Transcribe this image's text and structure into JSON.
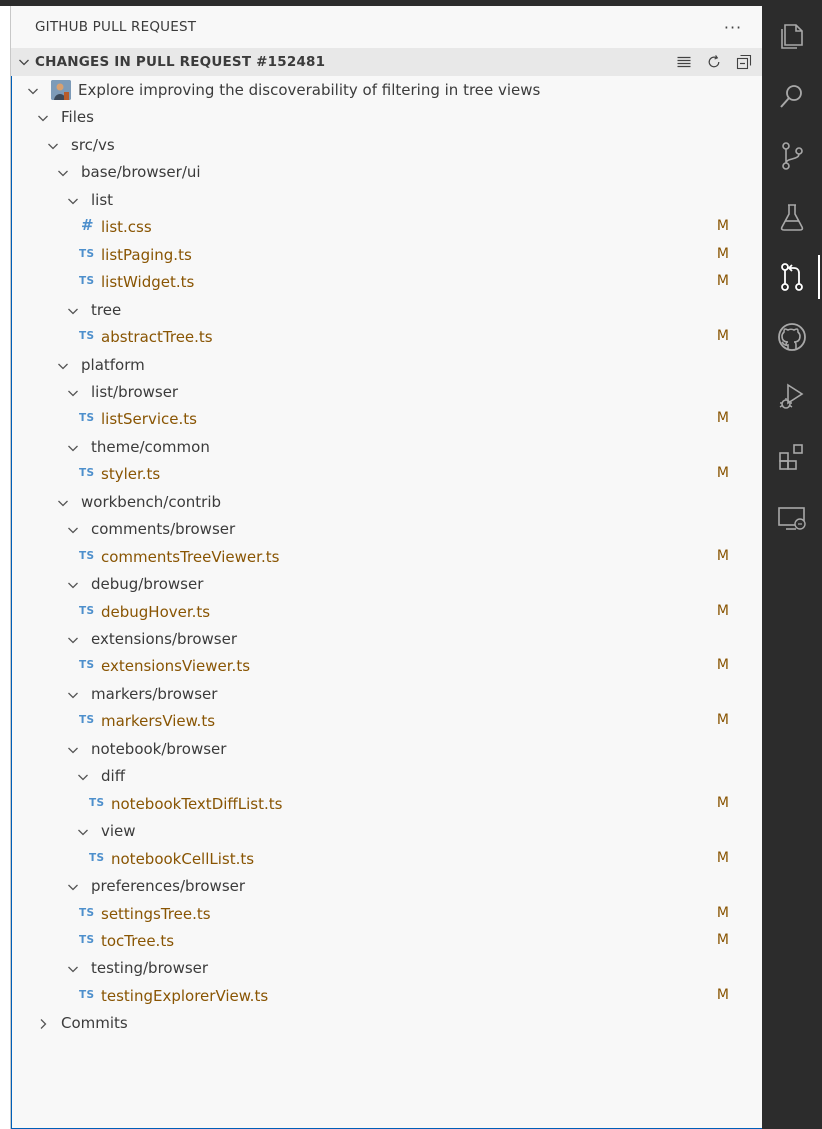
{
  "panel": {
    "title": "GITHUB PULL REQUEST",
    "more": "···"
  },
  "section": {
    "title": "CHANGES IN PULL REQUEST #152481"
  },
  "tree": [
    {
      "type": "pr",
      "depth": 0,
      "label": "Explore improving the discoverability of filtering in tree views"
    },
    {
      "type": "dir",
      "depth": 1,
      "label": "Files",
      "open": true
    },
    {
      "type": "dir",
      "depth": 2,
      "label": "src/vs",
      "open": true
    },
    {
      "type": "dir",
      "depth": 3,
      "label": "base/browser/ui",
      "open": true
    },
    {
      "type": "dir",
      "depth": 4,
      "label": "list",
      "open": true
    },
    {
      "type": "file",
      "depth": 5,
      "label": "list.css",
      "icon": "css",
      "badge": "M"
    },
    {
      "type": "file",
      "depth": 5,
      "label": "listPaging.ts",
      "icon": "ts",
      "badge": "M"
    },
    {
      "type": "file",
      "depth": 5,
      "label": "listWidget.ts",
      "icon": "ts",
      "badge": "M"
    },
    {
      "type": "dir",
      "depth": 4,
      "label": "tree",
      "open": true
    },
    {
      "type": "file",
      "depth": 5,
      "label": "abstractTree.ts",
      "icon": "ts",
      "badge": "M"
    },
    {
      "type": "dir",
      "depth": 3,
      "label": "platform",
      "open": true
    },
    {
      "type": "dir",
      "depth": 4,
      "label": "list/browser",
      "open": true
    },
    {
      "type": "file",
      "depth": 5,
      "label": "listService.ts",
      "icon": "ts",
      "badge": "M"
    },
    {
      "type": "dir",
      "depth": 4,
      "label": "theme/common",
      "open": true
    },
    {
      "type": "file",
      "depth": 5,
      "label": "styler.ts",
      "icon": "ts",
      "badge": "M"
    },
    {
      "type": "dir",
      "depth": 3,
      "label": "workbench/contrib",
      "open": true
    },
    {
      "type": "dir",
      "depth": 4,
      "label": "comments/browser",
      "open": true
    },
    {
      "type": "file",
      "depth": 5,
      "label": "commentsTreeViewer.ts",
      "icon": "ts",
      "badge": "M"
    },
    {
      "type": "dir",
      "depth": 4,
      "label": "debug/browser",
      "open": true
    },
    {
      "type": "file",
      "depth": 5,
      "label": "debugHover.ts",
      "icon": "ts",
      "badge": "M"
    },
    {
      "type": "dir",
      "depth": 4,
      "label": "extensions/browser",
      "open": true
    },
    {
      "type": "file",
      "depth": 5,
      "label": "extensionsViewer.ts",
      "icon": "ts",
      "badge": "M"
    },
    {
      "type": "dir",
      "depth": 4,
      "label": "markers/browser",
      "open": true
    },
    {
      "type": "file",
      "depth": 5,
      "label": "markersView.ts",
      "icon": "ts",
      "badge": "M"
    },
    {
      "type": "dir",
      "depth": 4,
      "label": "notebook/browser",
      "open": true
    },
    {
      "type": "dir",
      "depth": 5,
      "label": "diff",
      "open": true
    },
    {
      "type": "file",
      "depth": 6,
      "label": "notebookTextDiffList.ts",
      "icon": "ts",
      "badge": "M"
    },
    {
      "type": "dir",
      "depth": 5,
      "label": "view",
      "open": true
    },
    {
      "type": "file",
      "depth": 6,
      "label": "notebookCellList.ts",
      "icon": "ts",
      "badge": "M"
    },
    {
      "type": "dir",
      "depth": 4,
      "label": "preferences/browser",
      "open": true
    },
    {
      "type": "file",
      "depth": 5,
      "label": "settingsTree.ts",
      "icon": "ts",
      "badge": "M"
    },
    {
      "type": "file",
      "depth": 5,
      "label": "tocTree.ts",
      "icon": "ts",
      "badge": "M"
    },
    {
      "type": "dir",
      "depth": 4,
      "label": "testing/browser",
      "open": true
    },
    {
      "type": "file",
      "depth": 5,
      "label": "testingExplorerView.ts",
      "icon": "ts",
      "badge": "M"
    },
    {
      "type": "dir",
      "depth": 1,
      "label": "Commits",
      "open": false
    }
  ],
  "icons": {
    "ts": "TS",
    "css": "#"
  },
  "activity_bar": [
    {
      "name": "explorer-icon",
      "active": false
    },
    {
      "name": "search-icon",
      "active": false
    },
    {
      "name": "source-control-icon",
      "active": false
    },
    {
      "name": "testing-icon",
      "active": false
    },
    {
      "name": "pull-request-icon",
      "active": true
    },
    {
      "name": "github-icon",
      "active": false
    },
    {
      "name": "run-debug-icon",
      "active": false
    },
    {
      "name": "extensions-icon",
      "active": false
    },
    {
      "name": "remote-explorer-icon",
      "active": false
    }
  ],
  "colors": {
    "modified": "#895503",
    "ts": "#4d8fcc",
    "focus": "#005fb8",
    "activity_bg": "#2c2c2c"
  }
}
